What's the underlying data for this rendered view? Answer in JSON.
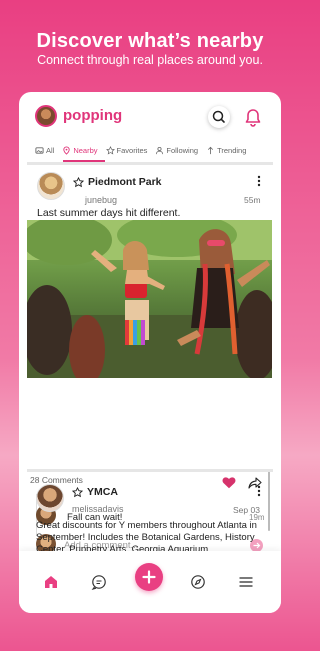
{
  "promo": {
    "title": "Discover what’s nearby",
    "subtitle": "Connect through real places around you."
  },
  "app": {
    "name": "popping"
  },
  "tabs": [
    {
      "label": "All",
      "icon": "image-icon"
    },
    {
      "label": "Nearby",
      "icon": "location-pin-icon",
      "active": true
    },
    {
      "label": "Favorites",
      "icon": "star-icon"
    },
    {
      "label": "Following",
      "icon": "user-icon"
    },
    {
      "label": "Trending",
      "icon": "arrow-up-icon"
    }
  ],
  "posts": [
    {
      "place": "Piedmont Park",
      "user": "junebug",
      "time": "55m",
      "caption": "Last summer days hit different.",
      "comments_count": "28 Comments",
      "liked": true,
      "comments": [
        {
          "text": "Fall can wait!",
          "time": "19m"
        }
      ],
      "add_comment_placeholder": "Add a comment..."
    },
    {
      "place": "YMCA",
      "user": "melissadavis",
      "time": "Sep 03",
      "text": "Great discounts for Y members throughout Atlanta in September! Includes the Botanical Gardens, History Center, Puppetry Arts, Georgia Aquarium"
    }
  ],
  "bottom_nav": [
    "home-icon",
    "chat-icon",
    "add-icon",
    "compass-icon",
    "menu-icon"
  ],
  "colors": {
    "accent": "#e0357a",
    "fab": "#e93f82"
  }
}
